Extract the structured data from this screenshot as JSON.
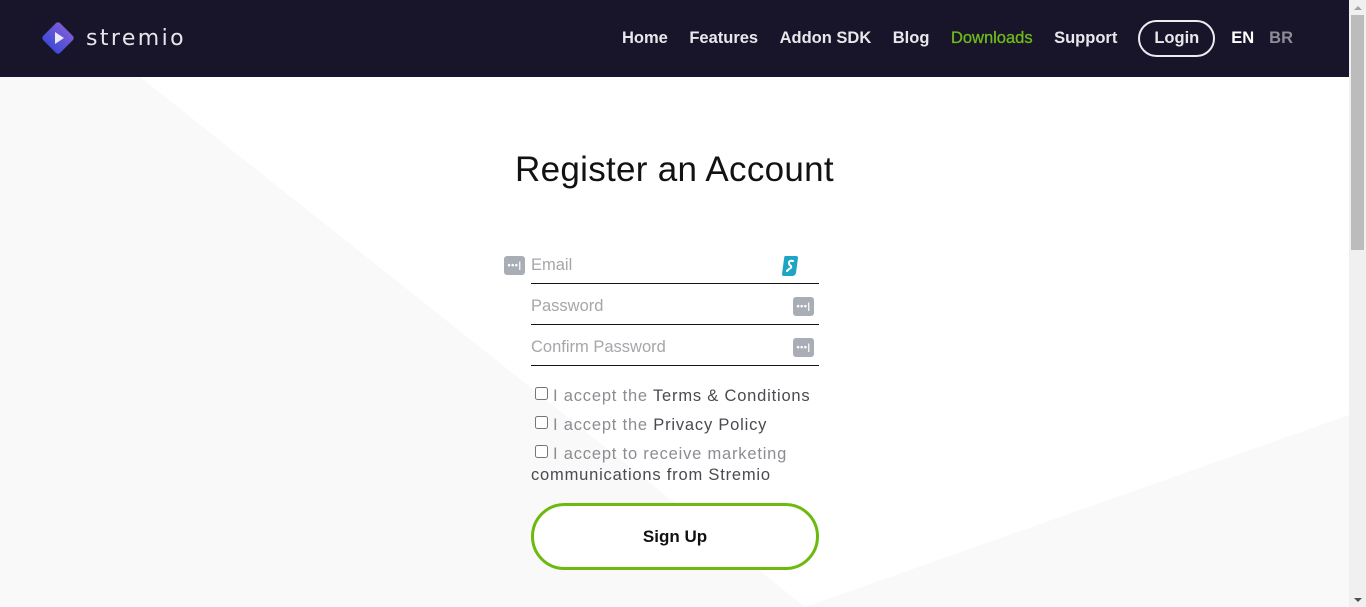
{
  "header": {
    "brand": "stremio",
    "nav": [
      {
        "label": "Home",
        "active": false
      },
      {
        "label": "Features",
        "active": false
      },
      {
        "label": "Addon SDK",
        "active": false
      },
      {
        "label": "Blog",
        "active": false
      },
      {
        "label": "Downloads",
        "active": true
      },
      {
        "label": "Support",
        "active": false
      }
    ],
    "login_label": "Login",
    "languages": [
      {
        "label": "EN",
        "selected": true
      },
      {
        "label": "BR",
        "selected": false
      }
    ]
  },
  "main": {
    "title": "Register an Account",
    "fields": {
      "email": {
        "placeholder": "Email",
        "value": ""
      },
      "password": {
        "placeholder": "Password",
        "value": ""
      },
      "confirm_password": {
        "placeholder": "Confirm Password",
        "value": ""
      }
    },
    "checkboxes": {
      "terms": {
        "prefix": "I accept the ",
        "link": "Terms & Conditions",
        "checked": false
      },
      "privacy": {
        "prefix": "I accept the ",
        "link": "Privacy Policy",
        "checked": false
      },
      "marketing": {
        "prefix": "I accept to receive marketing ",
        "suffix": "communications from Stremio",
        "checked": false
      }
    },
    "signup_label": "Sign Up"
  },
  "icons": {
    "password_manager": "password-manager-icon",
    "surfshark": "surfshark-extension-icon",
    "logo": "stremio-logo-icon"
  },
  "colors": {
    "header_bg": "#18152a",
    "accent_green": "#6bba0d",
    "nav_active": "#6fbb1b",
    "surfshark_teal": "#1ea5c6"
  }
}
